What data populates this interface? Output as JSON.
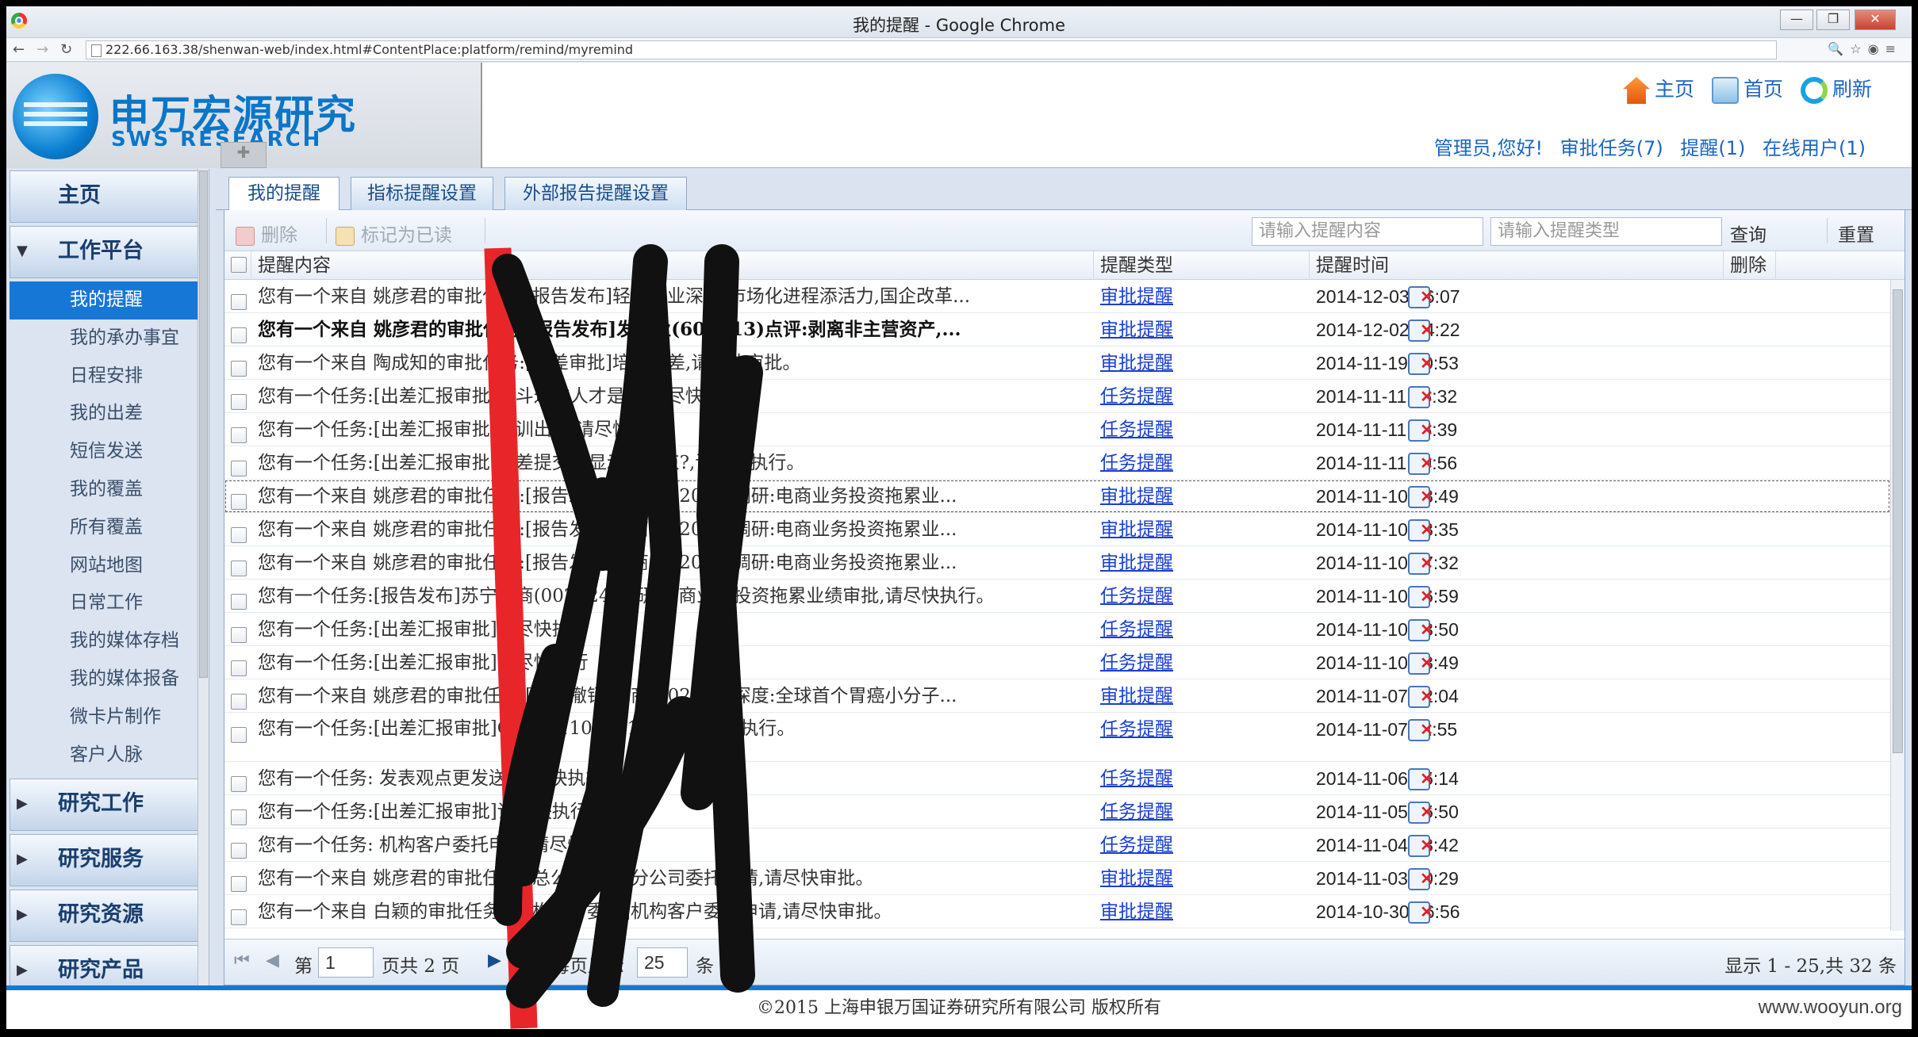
{
  "browser": {
    "title": "我的提醒 - Google Chrome",
    "url": "222.66.163.38/shenwan-web/index.html#ContentPlace:platform/remind/myremind"
  },
  "header": {
    "logo_cn": "申万宏源研究",
    "logo_en": "SWS RESEARCH",
    "links": {
      "home": "主页",
      "first": "首页",
      "refresh": "刷新"
    },
    "user": {
      "greeting": "管理员,您好!",
      "approval": "审批任务(7)",
      "remind": "提醒(1)",
      "online": "在线用户(1)"
    }
  },
  "sidebar": {
    "home": "主页",
    "work_platform": "工作平台",
    "items": [
      "我的提醒",
      "我的承办事宜",
      "日程安排",
      "我的出差",
      "短信发送",
      "我的覆盖",
      "所有覆盖",
      "网站地图",
      "日常工作",
      "我的媒体存档",
      "我的媒体报备",
      "微卡片制作",
      "客户人脉"
    ],
    "sections": [
      "研究工作",
      "研究服务",
      "研究资源",
      "研究产品"
    ]
  },
  "tabs": [
    "我的提醒",
    "指标提醒设置",
    "外部报告提醒设置"
  ],
  "toolbar": {
    "delete": "删除",
    "mark_read": "标记为已读",
    "content_placeholder": "请输入提醒内容",
    "type_placeholder": "请输入提醒类型",
    "search": "查询",
    "reset": "重置"
  },
  "grid": {
    "columns": [
      "提醒内容",
      "提醒类型",
      "提醒时间",
      "删除"
    ],
    "rows": [
      {
        "content": "您有一个来自 姚彦君的审批任务:[报告发布]轻工行业深度:市场化进程添活力,国企改革...",
        "type": "审批提醒",
        "time": "2014-12-03 16:07"
      },
      {
        "content": "您有一个来自 姚彦君的审批任务:[报告发布]发种业(600313)点评:剥离非主营资产,...",
        "type": "审批提醒",
        "time": "2014-12-02 14:22"
      },
      {
        "content": "您有一个来自 陶成知的审批任务:[出差审批]培训出差,请尽快审批。",
        "type": "审批提醒",
        "time": "2014-11-19 10:53"
      },
      {
        "content": "您有一个任务:[出差汇报审批]奋斗过的人才是的,请尽快执行。",
        "type": "任务提醒",
        "time": "2014-11-11 16:32"
      },
      {
        "content": "您有一个任务:[出差汇报审批]培训出差,请尽快执行",
        "type": "任务提醒",
        "time": "2014-11-11 15:39"
      },
      {
        "content": "您有一个任务:[出差汇报审批]出差提交后显示在结束?,请尽快执行。",
        "type": "任务提醒",
        "time": "2014-11-11 09:56"
      },
      {
        "content": "您有一个来自 姚彦君的审批任务:[报告发布]云商(002024)调研:电商业务投资拖累业...",
        "type": "审批提醒",
        "time": "2014-11-10 18:49"
      },
      {
        "content": "您有一个来自 姚彦君的审批任务:[报告发布]云商(002024)调研:电商业务投资拖累业...",
        "type": "审批提醒",
        "time": "2014-11-10 18:35"
      },
      {
        "content": "您有一个来自 姚彦君的审批任务:[报告发布]云商(002024)调研:电商业务投资拖累业...",
        "type": "审批提醒",
        "time": "2014-11-10 17:32"
      },
      {
        "content": "您有一个任务:[报告发布]苏宁云商(002024)调研:电商业务投资拖累业绩审批,请尽快执行。",
        "type": "任务提醒",
        "time": "2014-11-10 16:59"
      },
      {
        "content": "您有一个任务:[出差汇报审批]请尽快执行",
        "type": "任务提醒",
        "time": "2014-11-10 13:50"
      },
      {
        "content": "您有一个任务:[出差汇报审批]请尽快执行",
        "type": "任务提醒",
        "time": "2014-11-10 13:49"
      },
      {
        "content": "您有一个来自 姚彦君的审批任务:[报告撤销]云商(002024)深度:全球首个胃癌小分子...",
        "type": "审批提醒",
        "time": "2014-11-07 12:04"
      },
      {
        "content": "您有一个任务:[出差汇报审批]C20141105001 null,请尽快执行。",
        "type": "任务提醒",
        "time": "2014-11-07 11:55"
      },
      {
        "content": "您有一个任务: 发表观点更发送,请尽快执行",
        "type": "任务提醒",
        "time": "2014-11-06 15:14"
      },
      {
        "content": "您有一个任务:[出差汇报审批]请尽快执行",
        "type": "任务提醒",
        "time": "2014-11-05 15:50"
      },
      {
        "content": "您有一个任务: 机构客户委托申请,请尽快执行",
        "type": "任务提醒",
        "time": "2014-11-04 13:42"
      },
      {
        "content": "您有一个来自 姚彦君的审批任务:[总公司委托]分公司委托申请,请尽快审批。",
        "type": "审批提醒",
        "time": "2014-11-03 20:29"
      },
      {
        "content": "您有一个来自 白颖的审批任务:[机构客户委托]机构客户委托申请,请尽快审批。",
        "type": "审批提醒",
        "time": "2014-10-30 16:56"
      }
    ]
  },
  "pager": {
    "page_prefix": "第",
    "page_value": "1",
    "page_total": "页共 2 页",
    "per_page_label": "每页显示",
    "per_page_value": "25",
    "per_page_unit": "条",
    "summary": "显示 1 - 25,共 32 条"
  },
  "footer": {
    "copyright": "©2015 上海申银万国证券研究所有限公司 版权所有",
    "watermark": "www.wooyun.org"
  }
}
